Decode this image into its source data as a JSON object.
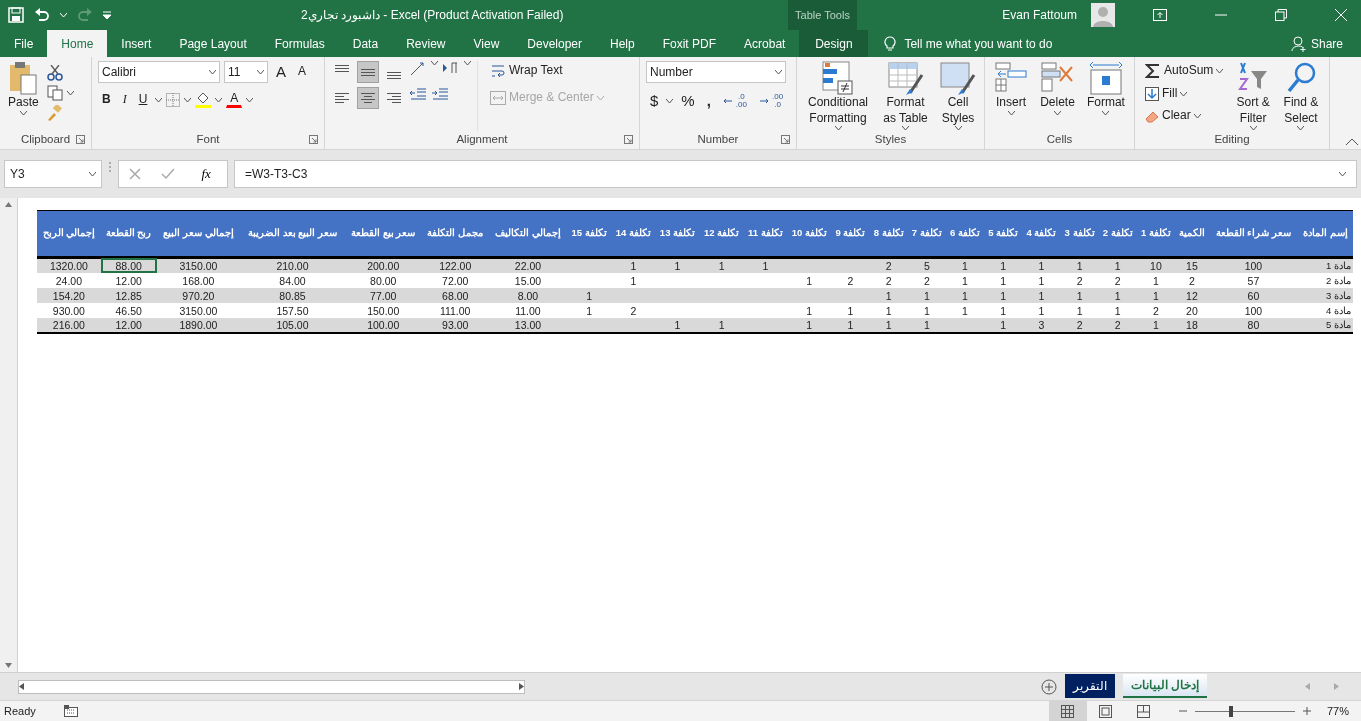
{
  "title_bar": {
    "title": "داشبورد تجاري2  -  Excel (Product Activation Failed)",
    "context_label": "Table Tools",
    "user_name": "Evan Fattoum"
  },
  "ribbon_tabs": [
    {
      "label": "File",
      "selected": false,
      "kind": "tab"
    },
    {
      "label": "Home",
      "selected": true,
      "kind": "tab"
    },
    {
      "label": "Insert",
      "selected": false,
      "kind": "tab"
    },
    {
      "label": "Page Layout",
      "selected": false,
      "kind": "tab"
    },
    {
      "label": "Formulas",
      "selected": false,
      "kind": "tab"
    },
    {
      "label": "Data",
      "selected": false,
      "kind": "tab"
    },
    {
      "label": "Review",
      "selected": false,
      "kind": "tab"
    },
    {
      "label": "View",
      "selected": false,
      "kind": "tab"
    },
    {
      "label": "Developer",
      "selected": false,
      "kind": "tab"
    },
    {
      "label": "Help",
      "selected": false,
      "kind": "tab"
    },
    {
      "label": "Foxit PDF",
      "selected": false,
      "kind": "tab"
    },
    {
      "label": "Acrobat",
      "selected": false,
      "kind": "tab"
    },
    {
      "label": "Design",
      "selected": false,
      "kind": "context"
    }
  ],
  "tell_me": "Tell me what you want to do",
  "share": "Share",
  "clipboard": {
    "label": "Clipboard",
    "paste": "Paste"
  },
  "font": {
    "label": "Font",
    "font_name": "Calibri",
    "font_size": "11",
    "grow": "A",
    "shrink": "A",
    "bold": "B",
    "italic": "I",
    "underline": "U",
    "font_color": "A"
  },
  "alignment": {
    "label": "Alignment",
    "wrap_text": "Wrap Text",
    "merge_center": {
      "label": "Merge & Center",
      "disabled": true
    },
    "tools": [
      {
        "kind": "top",
        "selected": false
      },
      {
        "kind": "middle",
        "selected": true
      },
      {
        "kind": "bottom",
        "selected": false
      },
      {
        "kind": "left",
        "selected": false
      },
      {
        "kind": "center",
        "selected": true
      },
      {
        "kind": "right",
        "selected": false
      }
    ]
  },
  "number": {
    "label": "Number",
    "format": "Number",
    "currency": "$",
    "percent": "%",
    "comma": ",",
    "decimals": [
      {
        "kind": "increase",
        "top": ".0",
        "bottom": ".00"
      },
      {
        "kind": "decrease",
        "top": ".00",
        "bottom": ".0"
      }
    ]
  },
  "styles": {
    "label": "Styles",
    "buttons": [
      {
        "label": "Conditional Formatting",
        "kind": "conditional"
      },
      {
        "label": "Format as Table",
        "kind": "table"
      },
      {
        "label": "Cell Styles",
        "kind": "cell"
      }
    ]
  },
  "cells": {
    "label": "Cells",
    "buttons": [
      {
        "label": "Insert",
        "kind": "insert"
      },
      {
        "label": "Delete",
        "kind": "delete"
      },
      {
        "label": "Format",
        "kind": "format"
      }
    ]
  },
  "editing": {
    "label": "Editing",
    "autosum": "AutoSum",
    "fill": "Fill",
    "clear": "Clear",
    "sort": "Sort & Filter",
    "find": "Find & Select"
  },
  "formula_bar": {
    "name_box": "Y3",
    "fx": "fx",
    "formula": "=W3-T3-C3"
  },
  "table": {
    "columns": [
      {
        "label": "إجمالي الربح"
      },
      {
        "label": "ربح القطعة"
      },
      {
        "label": "إجمالي سعر البيع"
      },
      {
        "label": "سعر البيع بعد الضريبة"
      },
      {
        "label": "سعر بيع القطعة"
      },
      {
        "label": "مجمل التكلفة"
      },
      {
        "label": "إجمالي التكاليف"
      },
      {
        "label": "تكلفة 15"
      },
      {
        "label": "تكلفة 14"
      },
      {
        "label": "تكلفة 13"
      },
      {
        "label": "تكلفة 12"
      },
      {
        "label": "تكلفة 11"
      },
      {
        "label": "تكلفة 10"
      },
      {
        "label": "تكلفة 9"
      },
      {
        "label": "تكلفة 8"
      },
      {
        "label": "تكلفة 7"
      },
      {
        "label": "تكلفة 6"
      },
      {
        "label": "تكلفة 5"
      },
      {
        "label": "تكلفة 4"
      },
      {
        "label": "تكلفة 3"
      },
      {
        "label": "تكلفة 2"
      },
      {
        "label": "تكلفة 1"
      },
      {
        "label": "الكمية"
      },
      {
        "label": "سعر شراء القطعة"
      },
      {
        "label": "إسم المادة"
      }
    ],
    "rows": [
      {
        "cells": [
          "1320.00",
          {
            "text": "88.00",
            "selected": true
          },
          "3150.00",
          "210.00",
          "200.00",
          "122.00",
          "22.00",
          null,
          "1",
          "1",
          "1",
          "1",
          null,
          null,
          "2",
          "5",
          "1",
          "1",
          "1",
          "1",
          "1",
          "10",
          "15",
          "100",
          "مادة 1"
        ]
      },
      {
        "cells": [
          "24.00",
          "12.00",
          "168.00",
          "84.00",
          "80.00",
          "72.00",
          "15.00",
          null,
          "1",
          null,
          null,
          null,
          "1",
          "2",
          "2",
          "2",
          "1",
          "1",
          "1",
          "2",
          "2",
          "1",
          "2",
          "57",
          "مادة 2"
        ]
      },
      {
        "cells": [
          "154.20",
          "12.85",
          "970.20",
          "80.85",
          "77.00",
          "68.00",
          "8.00",
          "1",
          null,
          null,
          null,
          null,
          null,
          null,
          "1",
          "1",
          "1",
          "1",
          "1",
          "1",
          "1",
          "1",
          "12",
          "60",
          "مادة 3"
        ]
      },
      {
        "cells": [
          "930.00",
          "46.50",
          "3150.00",
          "157.50",
          "150.00",
          "111.00",
          "11.00",
          "1",
          "2",
          null,
          null,
          null,
          "1",
          "1",
          "1",
          "1",
          "1",
          "1",
          "1",
          "1",
          "1",
          "2",
          "20",
          "100",
          "مادة 4"
        ]
      },
      {
        "cells": [
          "216.00",
          "12.00",
          "1890.00",
          "105.00",
          "100.00",
          "93.00",
          "13.00",
          null,
          null,
          "1",
          "1",
          null,
          "1",
          "1",
          "1",
          "1",
          null,
          "1",
          "3",
          "2",
          "2",
          "1",
          "18",
          "80",
          "مادة 5"
        ]
      }
    ]
  },
  "sheet_tabs": [
    {
      "label": "إدخال البيانات",
      "selected": true
    },
    {
      "label": "التقرير",
      "selected": false,
      "color": "#002060"
    }
  ],
  "status_bar": {
    "status": "Ready",
    "views": [
      {
        "kind": "normal",
        "selected": true
      },
      {
        "kind": "page-layout",
        "selected": false
      },
      {
        "kind": "page-break",
        "selected": false
      }
    ],
    "zoom": {
      "level": 0.36,
      "reading": "77%"
    }
  }
}
